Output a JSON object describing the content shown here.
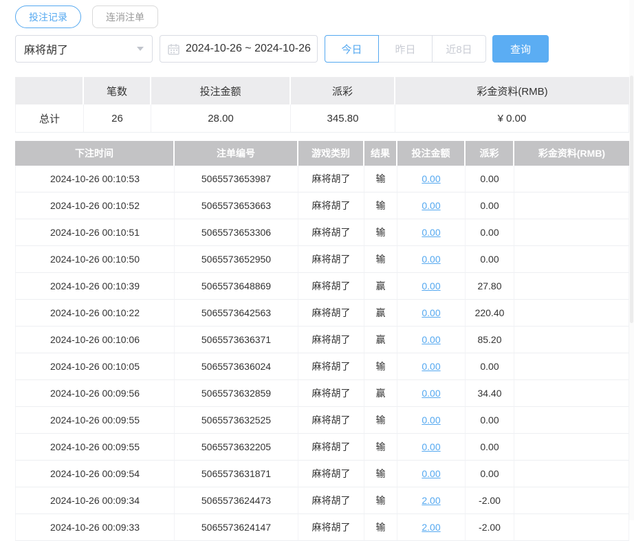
{
  "colors": {
    "accent": "#54a8f0",
    "search_button_bg": "#5badf3",
    "table_header_bg": "#c3c3c5",
    "summary_header_bg": "#ececee",
    "negative_red": "#ec6361"
  },
  "tabs": [
    {
      "label": "投注记录",
      "active": true
    },
    {
      "label": "连消注单",
      "active": false
    }
  ],
  "filters": {
    "game_select": {
      "value": "麻将胡了"
    },
    "date_range": {
      "value": "2024-10-26 ~ 2024-10-26"
    },
    "quick_ranges": [
      {
        "label": "今日",
        "active": true
      },
      {
        "label": "昨日",
        "active": false
      },
      {
        "label": "近8日",
        "active": false
      }
    ],
    "search_label": "查询"
  },
  "summary": {
    "headers": [
      "",
      "笔数",
      "投注金额",
      "派彩",
      "彩金资料(RMB)"
    ],
    "row_label": "总计",
    "count": "26",
    "bet_amount": "28.00",
    "payout": "345.80",
    "bonus": "¥ 0.00"
  },
  "table": {
    "headers": [
      "下注时间",
      "注单编号",
      "游戏类别",
      "结果",
      "投注金额",
      "派彩",
      "彩金资料(RMB)"
    ],
    "rows": [
      {
        "time": "2024-10-26 00:10:53",
        "order_id": "5065573653987",
        "game": "麻将胡了",
        "result": "输",
        "bet": "0.00",
        "payout": "0.00",
        "bonus": ""
      },
      {
        "time": "2024-10-26 00:10:52",
        "order_id": "5065573653663",
        "game": "麻将胡了",
        "result": "输",
        "bet": "0.00",
        "payout": "0.00",
        "bonus": ""
      },
      {
        "time": "2024-10-26 00:10:51",
        "order_id": "5065573653306",
        "game": "麻将胡了",
        "result": "输",
        "bet": "0.00",
        "payout": "0.00",
        "bonus": ""
      },
      {
        "time": "2024-10-26 00:10:50",
        "order_id": "5065573652950",
        "game": "麻将胡了",
        "result": "输",
        "bet": "0.00",
        "payout": "0.00",
        "bonus": ""
      },
      {
        "time": "2024-10-26 00:10:39",
        "order_id": "5065573648869",
        "game": "麻将胡了",
        "result": "赢",
        "bet": "0.00",
        "payout": "27.80",
        "bonus": ""
      },
      {
        "time": "2024-10-26 00:10:22",
        "order_id": "5065573642563",
        "game": "麻将胡了",
        "result": "赢",
        "bet": "0.00",
        "payout": "220.40",
        "bonus": ""
      },
      {
        "time": "2024-10-26 00:10:06",
        "order_id": "5065573636371",
        "game": "麻将胡了",
        "result": "赢",
        "bet": "0.00",
        "payout": "85.20",
        "bonus": ""
      },
      {
        "time": "2024-10-26 00:10:05",
        "order_id": "5065573636024",
        "game": "麻将胡了",
        "result": "输",
        "bet": "0.00",
        "payout": "0.00",
        "bonus": ""
      },
      {
        "time": "2024-10-26 00:09:56",
        "order_id": "5065573632859",
        "game": "麻将胡了",
        "result": "赢",
        "bet": "0.00",
        "payout": "34.40",
        "bonus": ""
      },
      {
        "time": "2024-10-26 00:09:55",
        "order_id": "5065573632525",
        "game": "麻将胡了",
        "result": "输",
        "bet": "0.00",
        "payout": "0.00",
        "bonus": ""
      },
      {
        "time": "2024-10-26 00:09:55",
        "order_id": "5065573632205",
        "game": "麻将胡了",
        "result": "输",
        "bet": "0.00",
        "payout": "0.00",
        "bonus": ""
      },
      {
        "time": "2024-10-26 00:09:54",
        "order_id": "5065573631871",
        "game": "麻将胡了",
        "result": "输",
        "bet": "0.00",
        "payout": "0.00",
        "bonus": ""
      },
      {
        "time": "2024-10-26 00:09:34",
        "order_id": "5065573624473",
        "game": "麻将胡了",
        "result": "输",
        "bet": "2.00",
        "payout": "-2.00",
        "bonus": ""
      },
      {
        "time": "2024-10-26 00:09:33",
        "order_id": "5065573624147",
        "game": "麻将胡了",
        "result": "输",
        "bet": "2.00",
        "payout": "-2.00",
        "bonus": ""
      }
    ]
  }
}
